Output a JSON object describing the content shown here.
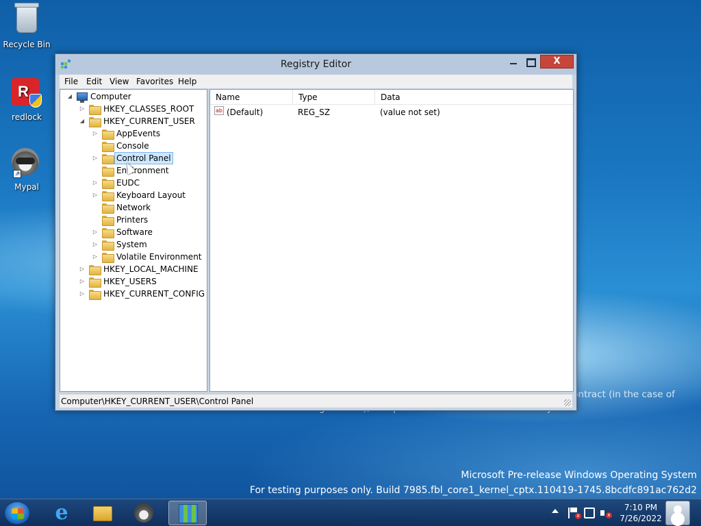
{
  "desktop": {
    "icons": [
      {
        "label": "Recycle Bin"
      },
      {
        "label": "redlock"
      },
      {
        "label": "Mypal"
      }
    ],
    "legal_text": "...linary action up to and ...termination of an assignment or contract (in the case of contingent staff), and potential civil and criminal liability.",
    "os_line1": "Microsoft Pre-release Windows Operating System",
    "os_line2": "For testing purposes only. Build 7985.fbl_core1_kernel_cptx.110419-1745.8bcdfc891ac762d2"
  },
  "window": {
    "title": "Registry Editor",
    "close_label": "X",
    "menu": [
      "File",
      "Edit",
      "View",
      "Favorites",
      "Help"
    ],
    "tree": {
      "root": "Computer",
      "hives": [
        {
          "label": "HKEY_CLASSES_ROOT"
        },
        {
          "label": "HKEY_CURRENT_USER"
        },
        {
          "label": "HKEY_LOCAL_MACHINE"
        },
        {
          "label": "HKEY_USERS"
        },
        {
          "label": "HKEY_CURRENT_CONFIG"
        }
      ],
      "current_user_children": [
        {
          "label": "AppEvents"
        },
        {
          "label": "Console"
        },
        {
          "label": "Control Panel"
        },
        {
          "label": "Environment"
        },
        {
          "label": "EUDC"
        },
        {
          "label": "Keyboard Layout"
        },
        {
          "label": "Network"
        },
        {
          "label": "Printers"
        },
        {
          "label": "Software"
        },
        {
          "label": "System"
        },
        {
          "label": "Volatile Environment"
        }
      ],
      "selected": "Control Panel"
    },
    "list": {
      "columns": [
        "Name",
        "Type",
        "Data"
      ],
      "rows": [
        {
          "name": "(Default)",
          "type": "REG_SZ",
          "data": "(value not set)",
          "icon": "string-value-icon"
        }
      ]
    },
    "status_path": "Computer\\HKEY_CURRENT_USER\\Control Panel"
  },
  "taskbar": {
    "apps": [
      "internet-explorer",
      "file-explorer",
      "mypal",
      "registry-editor"
    ],
    "active_app": "registry-editor",
    "time": "7:10 PM",
    "date": "7/26/2022"
  },
  "colors": {
    "close_button": "#c7463c",
    "selection": "#cde8ff",
    "desktop_blue": "#1b78c2"
  }
}
